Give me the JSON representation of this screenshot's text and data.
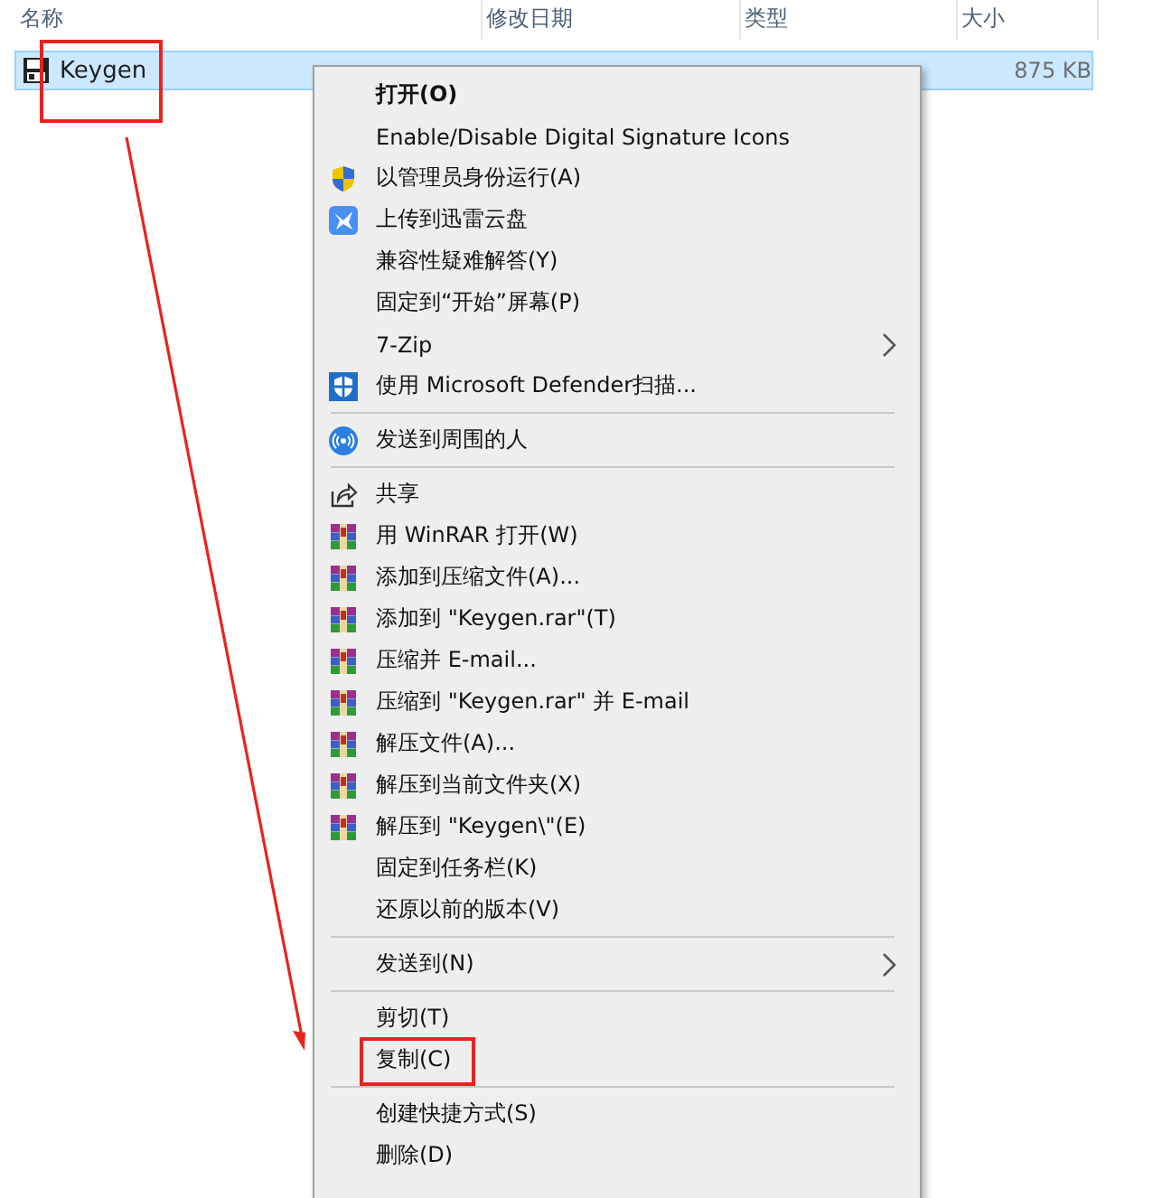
{
  "columns": [
    {
      "label": "名称"
    },
    {
      "label": "修改日期"
    },
    {
      "label": "类型"
    },
    {
      "label": "大小"
    }
  ],
  "files": [
    {
      "name": "Keygen",
      "size": "875 KB",
      "selected": true,
      "highlighted": true
    }
  ],
  "context_menu": {
    "items": [
      {
        "kind": "text",
        "label": "打开(O)",
        "default": true,
        "submenu": false,
        "highlighted": false
      },
      {
        "kind": "text",
        "label": "Enable/Disable Digital Signature Icons",
        "default": false,
        "submenu": false,
        "highlighted": false
      },
      {
        "kind": "uac",
        "label": "以管理员身份运行(A)",
        "default": false,
        "submenu": false,
        "highlighted": false
      },
      {
        "kind": "cloud",
        "label": "上传到迅雷云盘",
        "default": false,
        "submenu": false,
        "highlighted": false
      },
      {
        "kind": "text",
        "label": "兼容性疑难解答(Y)",
        "default": false,
        "submenu": false,
        "highlighted": false
      },
      {
        "kind": "text",
        "label": "固定到“开始”屏幕(P)",
        "default": false,
        "submenu": false,
        "highlighted": false
      },
      {
        "kind": "text",
        "label": "7-Zip",
        "default": false,
        "submenu": true,
        "highlighted": false
      },
      {
        "kind": "defender",
        "label": "使用 Microsoft Defender扫描...",
        "default": false,
        "submenu": false,
        "highlighted": false
      },
      {
        "kind": "separator"
      },
      {
        "kind": "nearby",
        "label": "发送到周围的人",
        "default": false,
        "submenu": false,
        "highlighted": false
      },
      {
        "kind": "separator"
      },
      {
        "kind": "share",
        "label": "共享",
        "default": false,
        "submenu": false,
        "highlighted": false
      },
      {
        "kind": "archive",
        "label": "用 WinRAR 打开(W)",
        "default": false,
        "submenu": false,
        "highlighted": false
      },
      {
        "kind": "archive",
        "label": "添加到压缩文件(A)...",
        "default": false,
        "submenu": false,
        "highlighted": false
      },
      {
        "kind": "archive",
        "label": "添加到 \"Keygen.rar\"(T)",
        "default": false,
        "submenu": false,
        "highlighted": false
      },
      {
        "kind": "archive",
        "label": "压缩并 E-mail...",
        "default": false,
        "submenu": false,
        "highlighted": false
      },
      {
        "kind": "archive",
        "label": "压缩到 \"Keygen.rar\" 并 E-mail",
        "default": false,
        "submenu": false,
        "highlighted": false
      },
      {
        "kind": "archive",
        "label": "解压文件(A)...",
        "default": false,
        "submenu": false,
        "highlighted": false
      },
      {
        "kind": "archive",
        "label": "解压到当前文件夹(X)",
        "default": false,
        "submenu": false,
        "highlighted": false
      },
      {
        "kind": "archive",
        "label": "解压到 \"Keygen\\\"(E)",
        "default": false,
        "submenu": false,
        "highlighted": false
      },
      {
        "kind": "text",
        "label": "固定到任务栏(K)",
        "default": false,
        "submenu": false,
        "highlighted": false
      },
      {
        "kind": "text",
        "label": "还原以前的版本(V)",
        "default": false,
        "submenu": false,
        "highlighted": false
      },
      {
        "kind": "separator"
      },
      {
        "kind": "text",
        "label": "发送到(N)",
        "default": false,
        "submenu": true,
        "highlighted": false
      },
      {
        "kind": "separator"
      },
      {
        "kind": "text",
        "label": "剪切(T)",
        "default": false,
        "submenu": false,
        "highlighted": false
      },
      {
        "kind": "text",
        "label": "复制(C)",
        "default": false,
        "submenu": false,
        "highlighted": true
      },
      {
        "kind": "separator"
      },
      {
        "kind": "text",
        "label": "创建快捷方式(S)",
        "default": false,
        "submenu": false,
        "highlighted": false
      },
      {
        "kind": "text",
        "label": "删除(D)",
        "default": false,
        "submenu": false,
        "highlighted": false
      }
    ]
  }
}
